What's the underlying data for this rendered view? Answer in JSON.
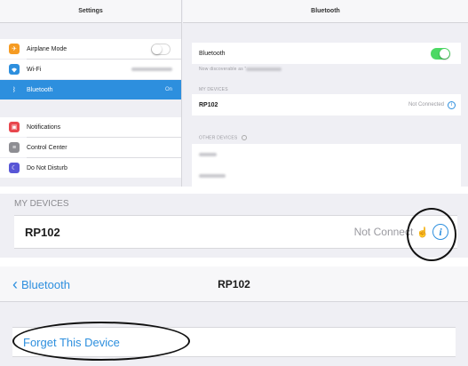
{
  "panel1": {
    "left_title": "Settings",
    "right_title": "Bluetooth",
    "left_items": [
      {
        "label": "Airplane Mode",
        "icon": "airplane-icon",
        "color": "#f59b23"
      },
      {
        "label": "Wi-Fi",
        "icon": "wifi-icon",
        "color": "#2d8fde"
      },
      {
        "label": "Bluetooth",
        "value": "On",
        "icon": "bluetooth-icon",
        "color": "#2d8fde"
      },
      {
        "label": "Notifications",
        "icon": "notifications-icon",
        "color": "#e8474e"
      },
      {
        "label": "Control Center",
        "icon": "control-center-icon",
        "color": "#8e8e93"
      },
      {
        "label": "Do Not Disturb",
        "icon": "moon-icon",
        "color": "#5856d6"
      }
    ],
    "bt_label": "Bluetooth",
    "discoverable": "Now discoverable as “",
    "my_devices_header": "MY DEVICES",
    "device_name": "RP102",
    "device_status": "Not Connected",
    "other_devices_header": "OTHER DEVICES"
  },
  "panel2": {
    "header": "MY DEVICES",
    "device_name": "RP102",
    "device_status": "Not Connect"
  },
  "panel3": {
    "back_label": "Bluetooth",
    "title": "RP102",
    "forget_label": "Forget This Device"
  },
  "colors": {
    "accent": "#2d8fde",
    "switch_on": "#4cd964"
  }
}
